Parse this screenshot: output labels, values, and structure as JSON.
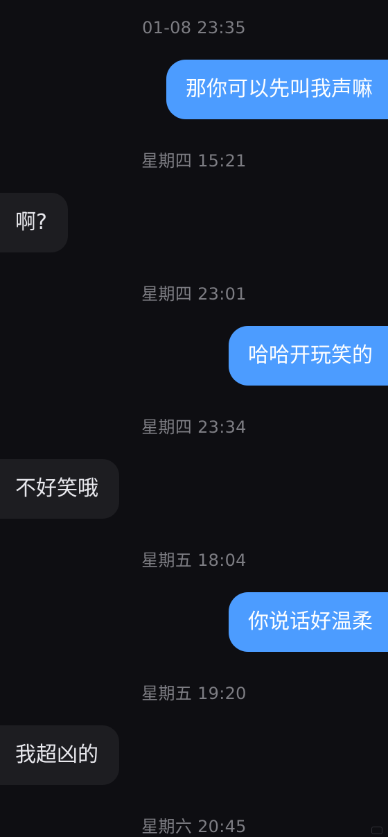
{
  "messages": [
    {
      "time": "01-08 23:35",
      "direction": "out",
      "text": "那你可以先叫我声嘛"
    },
    {
      "time": "星期四 15:21",
      "direction": "in",
      "text": "啊?"
    },
    {
      "time": "星期四 23:01",
      "direction": "out",
      "text": "哈哈开玩笑的"
    },
    {
      "time": "星期四 23:34",
      "direction": "in",
      "text": "不好笑哦"
    },
    {
      "time": "星期五 18:04",
      "direction": "out",
      "text": "你说话好温柔"
    },
    {
      "time": "星期五 19:20",
      "direction": "in",
      "text": "我超凶的"
    },
    {
      "time": "星期六 20:45"
    }
  ],
  "colors": {
    "background": "#0e0e12",
    "outgoing_bubble": "#4c9cff",
    "incoming_bubble": "#1d1d21",
    "timestamp_text": "#7d7d83"
  },
  "icons": {
    "corner_mark": "watermark-icon"
  }
}
